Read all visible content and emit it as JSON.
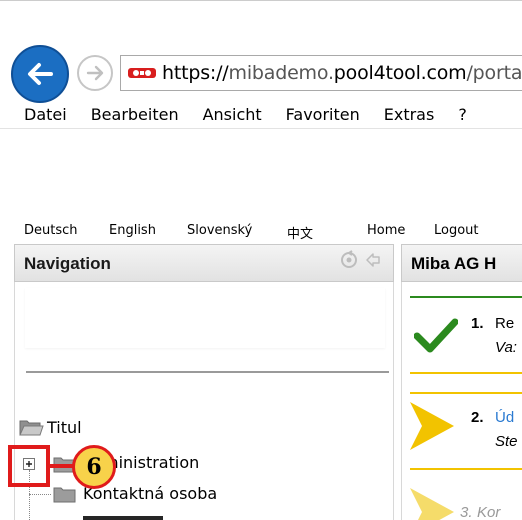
{
  "browser": {
    "address": {
      "scheme": "https://",
      "host_pre": "mibademo.",
      "host_bold": "pool4tool.com",
      "path": "/portal/n"
    },
    "menu": [
      "Datei",
      "Bearbeiten",
      "Ansicht",
      "Favoriten",
      "Extras",
      "?"
    ]
  },
  "langbar": [
    "Deutsch",
    "English",
    "Slovenský",
    "中文",
    "Home",
    "Logout"
  ],
  "navigation": {
    "title": "Navigation",
    "tree": {
      "root": "Titul",
      "items": [
        "ministration",
        "Kontaktná osoba"
      ]
    }
  },
  "right_panel": {
    "title": "Miba AG H",
    "steps": [
      {
        "num": "1.",
        "title": "Re",
        "sub": "Va:"
      },
      {
        "num": "2.",
        "title": "Úd",
        "sub": "Ste"
      },
      {
        "num": "3.",
        "title": "Kor",
        "sub": ""
      }
    ]
  },
  "annotation": {
    "callout_number": "6"
  },
  "colors": {
    "accent_red": "#e01b1b",
    "callout_fill": "#f8d24a",
    "check_green": "#2b8a1e",
    "arrow_yellow": "#f2c300",
    "link_blue": "#2a7ad1",
    "browser_blue": "#1b6ec2"
  }
}
